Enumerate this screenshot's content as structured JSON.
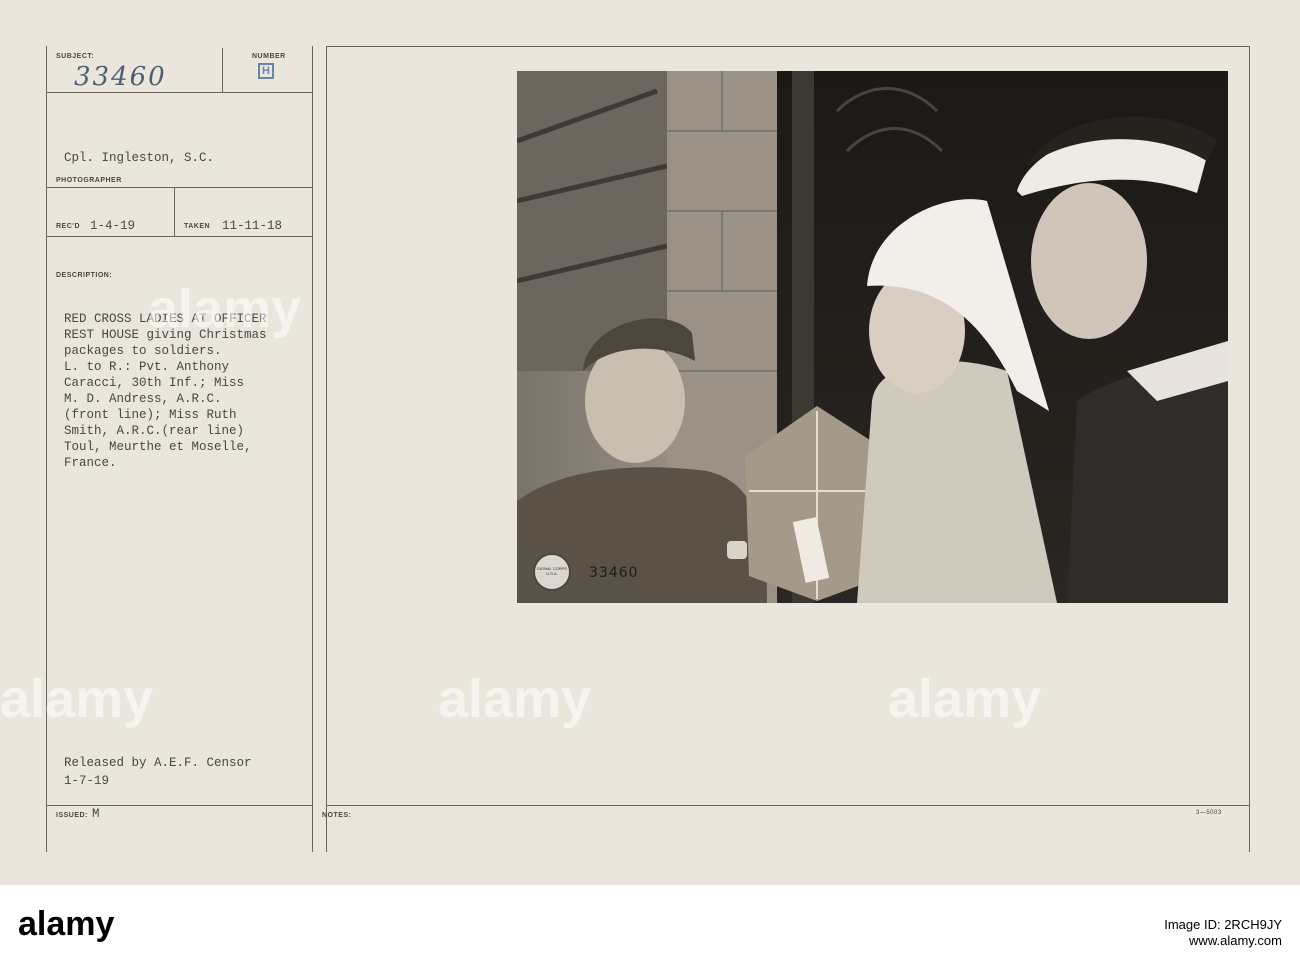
{
  "card": {
    "subject_label": "SUBJECT:",
    "subject_number": "33460",
    "number_label": "NUMBER",
    "number_value": "H",
    "photographer_name": "Cpl. Ingleston, S.C.",
    "photographer_label": "PHOTOGRAPHER",
    "recd_label": "REC'D",
    "recd_date": "1-4-19",
    "taken_label": "TAKEN",
    "taken_date": "11-11-18",
    "description_label": "DESCRIPTION:",
    "description_lines": [
      "RED CROSS LADIES AT OFFICER",
      "REST HOUSE giving Christmas",
      "packages to soldiers.",
      "L. to R.: Pvt. Anthony",
      "Caracci, 30th Inf.; Miss",
      "M. D. Andress, A.R.C.",
      "(front line); Miss Ruth",
      "Smith, A.R.C.(rear line)",
      "Toul, Meurthe et Moselle,",
      "France."
    ],
    "released_line1": "Released by A.E.F. Censor",
    "released_line2": "1-7-19",
    "issued_label": "ISSUED:",
    "issued_value": "M",
    "notes_label": "NOTES:",
    "form_code": "3—5003"
  },
  "photo": {
    "stamp_text": "SIGNAL CORPS U.S.A.",
    "stamp_number": "33460"
  },
  "watermark": "alamy",
  "footer": {
    "logo": "alamy",
    "image_id_label": "Image ID: 2RCH9JY",
    "site": "www.alamy.com"
  }
}
